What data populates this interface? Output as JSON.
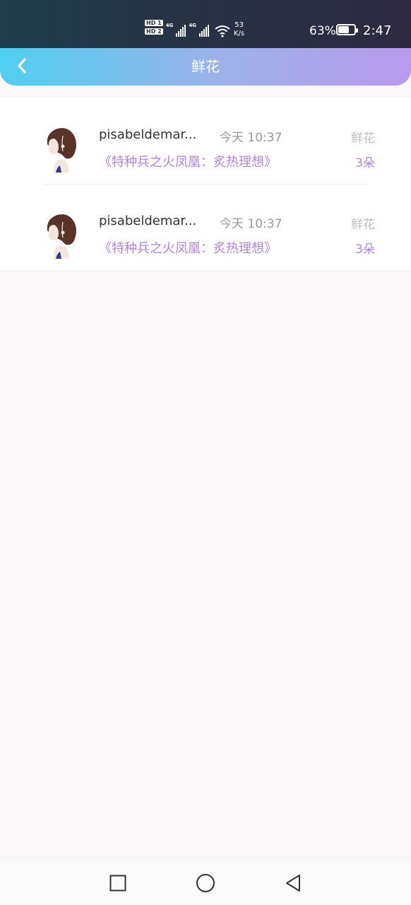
{
  "status_bar": {
    "sim1": "HD 1",
    "sim2": "HD 2",
    "network1": "4G",
    "network2": "4G",
    "speed_value": "53",
    "speed_unit": "K/s",
    "battery_percent": "63%",
    "battery_level": 0.63,
    "time": "2:47"
  },
  "header": {
    "title": "鲜花",
    "back_icon": "chevron-left-icon"
  },
  "colors": {
    "header_gradient_start": "#4fd0f0",
    "header_gradient_end": "#b99aec",
    "accent_purple": "#b385d9",
    "muted_text": "#999999"
  },
  "records": [
    {
      "username": "pisabeldemar...",
      "time": "今天 10:37",
      "gift_type": "鲜花",
      "book_title": "《特种兵之火凤凰：炙热理想》",
      "quantity": "3朵"
    },
    {
      "username": "pisabeldemar...",
      "time": "今天 10:37",
      "gift_type": "鲜花",
      "book_title": "《特种兵之火凤凰：炙热理想》",
      "quantity": "3朵"
    }
  ],
  "nav_bar": {
    "recent_icon": "square-icon",
    "home_icon": "circle-icon",
    "back_icon": "triangle-back-icon"
  }
}
